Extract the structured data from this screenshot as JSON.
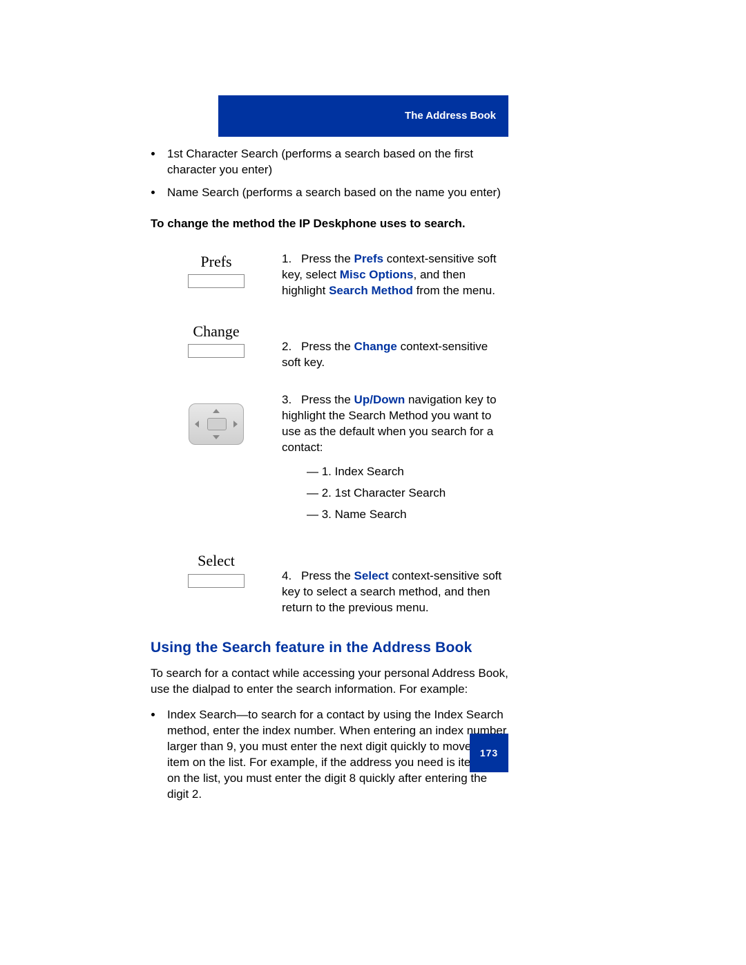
{
  "header": {
    "title": "The Address Book"
  },
  "intro_bullets": [
    "1st Character Search (performs a search based on the first character you enter)",
    "Name Search (performs a search based on the name you enter)"
  ],
  "instruction_heading": "To change the method the IP Deskphone uses to search.",
  "softkeys": {
    "prefs": "Prefs",
    "change": "Change",
    "select": "Select"
  },
  "steps": {
    "s1": {
      "num": "1.",
      "t1": "Press the ",
      "k1": "Prefs",
      "t2": " context-sensitive soft key, select ",
      "k2": "Misc Options",
      "t3": ", and then highlight ",
      "k3": "Search Method",
      "t4": " from the menu."
    },
    "s2": {
      "num": "2.",
      "t1": "Press the ",
      "k1": "Change",
      "t2": " context-sensitive soft key."
    },
    "s3": {
      "num": "3.",
      "t1": "Press the ",
      "k1": "Up",
      "slash": "/",
      "k2": "Down",
      "t2": " navigation key to highlight the Search Method you want to use as the default when you search for a contact:",
      "opts": [
        "—   1. Index Search",
        "—   2. 1st Character Search",
        "—   3. Name Search"
      ]
    },
    "s4": {
      "num": "4.",
      "t1": "Press the ",
      "k1": "Select",
      "t2": " context-sensitive soft key to select a search method, and then return to the previous menu."
    }
  },
  "section2": {
    "heading": "Using the Search feature in the Address Book",
    "para": "To search for a contact while accessing your personal Address Book, use the dialpad to enter the search information. For example:",
    "bullet": "Index Search—to search for a contact by using the Index Search method, enter the index number. When entering an index number larger than 9, you must enter the next digit quickly to move to that item on the list. For example, if the address you need is item 28 on the list, you must enter the digit 8 quickly after entering the digit 2."
  },
  "page_number": "173"
}
